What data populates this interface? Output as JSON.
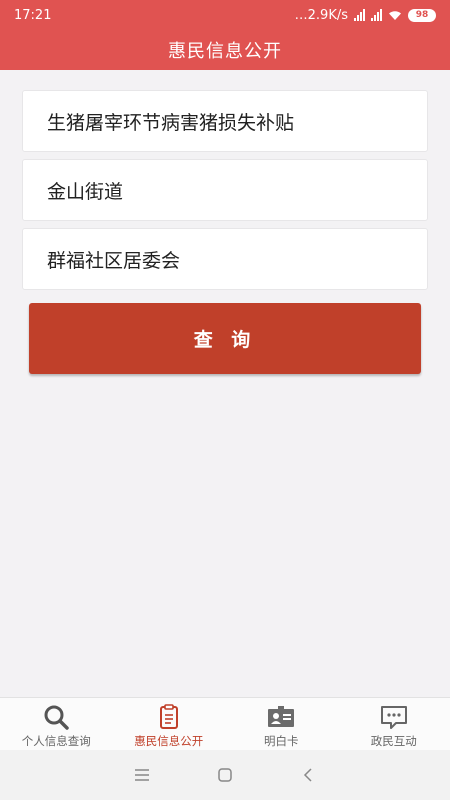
{
  "status_bar": {
    "time": "17:21",
    "network_speed": "2.9K/s",
    "battery": "98",
    "icons": [
      "signal-icon",
      "signal-icon",
      "wifi-icon",
      "battery-icon"
    ]
  },
  "header": {
    "title": "惠民信息公开"
  },
  "form": {
    "fields": [
      {
        "value": "生猪屠宰环节病害猪损失补贴"
      },
      {
        "value": "金山街道"
      },
      {
        "value": "群福社区居委会"
      }
    ],
    "query_label": "查 询"
  },
  "tabbar": {
    "items": [
      {
        "label": "个人信息查询",
        "icon": "search-icon",
        "active": false
      },
      {
        "label": "惠民信息公开",
        "icon": "clipboard-icon",
        "active": true
      },
      {
        "label": "明白卡",
        "icon": "id-card-icon",
        "active": false
      },
      {
        "label": "政民互动",
        "icon": "chat-icon",
        "active": false
      }
    ]
  },
  "colors": {
    "header": "#e05351",
    "accent": "#c0402a",
    "background": "#f3f2f4"
  }
}
